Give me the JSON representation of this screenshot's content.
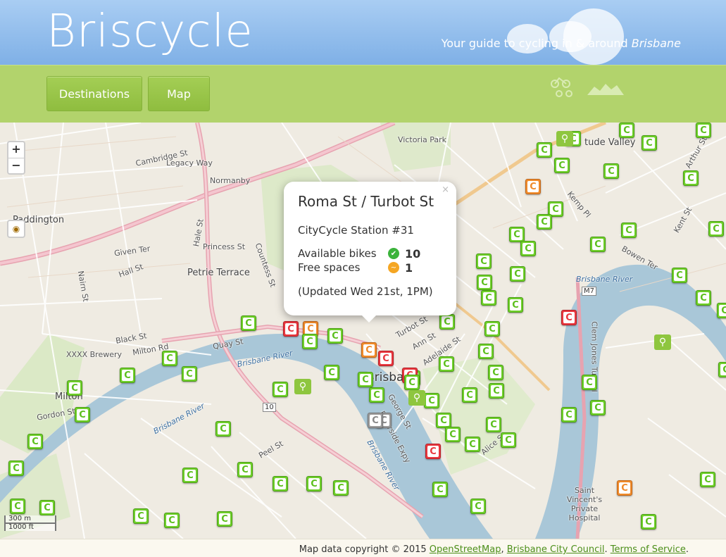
{
  "header": {
    "logo": "Briscycle",
    "tagline_prefix": "Your guide to cycling in & around ",
    "tagline_emph": "Brisbane"
  },
  "nav": {
    "destinations": "Destinations",
    "map": "Map"
  },
  "map": {
    "zoom_in": "+",
    "zoom_out": "−",
    "labels": {
      "paddington": "Paddington",
      "normanby": "Normanby",
      "petrie_terrace": "Petrie Terrace",
      "milton": "Milton",
      "victoria_park": "Victoria Park",
      "brisbane_river_1": "Brisbane River",
      "brisbane_river_2": "Brisbane River",
      "brisbane_river_3": "Brisbane River",
      "brisbane_river_4": "Brisbane River",
      "xxxx_brewery": "XXXX Brewery",
      "legacy_way": "Legacy Way",
      "fortitude_valley": "tude Valley",
      "st_vincents": "Saint Vincent's Private Hospital",
      "m7": "M7",
      "r10": "10",
      "brisbane_city": "Brisban",
      "milton_rd": "Milton Rd",
      "given_ter": "Given Ter",
      "princess_st": "Princess St",
      "countess_st": "Countess St",
      "quay_st": "Quay St",
      "cambridge_st": "Cambridge St",
      "hale_st": "Hale St",
      "black_st": "Black St",
      "riverside_expy": "Riverside Expy",
      "clem_jones_tunnel": "Clem Jones Tunnel",
      "peel_st": "Peel St",
      "alice_st": "Alice St",
      "kemp_pl": "Kemp Pl",
      "bowen_ter": "Bowen Ter",
      "kent_st": "Kent St",
      "arthur_st": "Arthur St",
      "turbot_st": "Turbot St",
      "ann_st": "Ann St",
      "adelaide_st": "Adelaide St",
      "george_st": "George St",
      "gordon_st": "Gordon St",
      "hall_st": "Hall St",
      "nairn_st": "Nairn St"
    }
  },
  "popup": {
    "close": "×",
    "title": "Roma St / Turbot St",
    "subtitle": "CityCycle Station #31",
    "bikes_label": "Available bikes",
    "bikes_value": "10",
    "spaces_label": "Free spaces",
    "spaces_value": "1",
    "updated": "(Updated Wed 21st, 1PM)"
  },
  "scale": {
    "metric": "300 m",
    "imperial": "1000 ft"
  },
  "footer": {
    "prefix": "Map data copyright © 2015 ",
    "osm": "OpenStreetMap",
    "sep1": ", ",
    "bcc": "Brisbane City Council",
    "sep2": ". ",
    "tos": "Terms of Service",
    "suffix": "."
  },
  "colors": {
    "header_sky": "#7fb0e6",
    "nav_green": "#b2d36c",
    "marker_green": "#6fcf2a",
    "marker_red": "#e8373e",
    "marker_orange": "#f08b2b",
    "river": "#a9c7d8"
  },
  "marker_letter": "C"
}
